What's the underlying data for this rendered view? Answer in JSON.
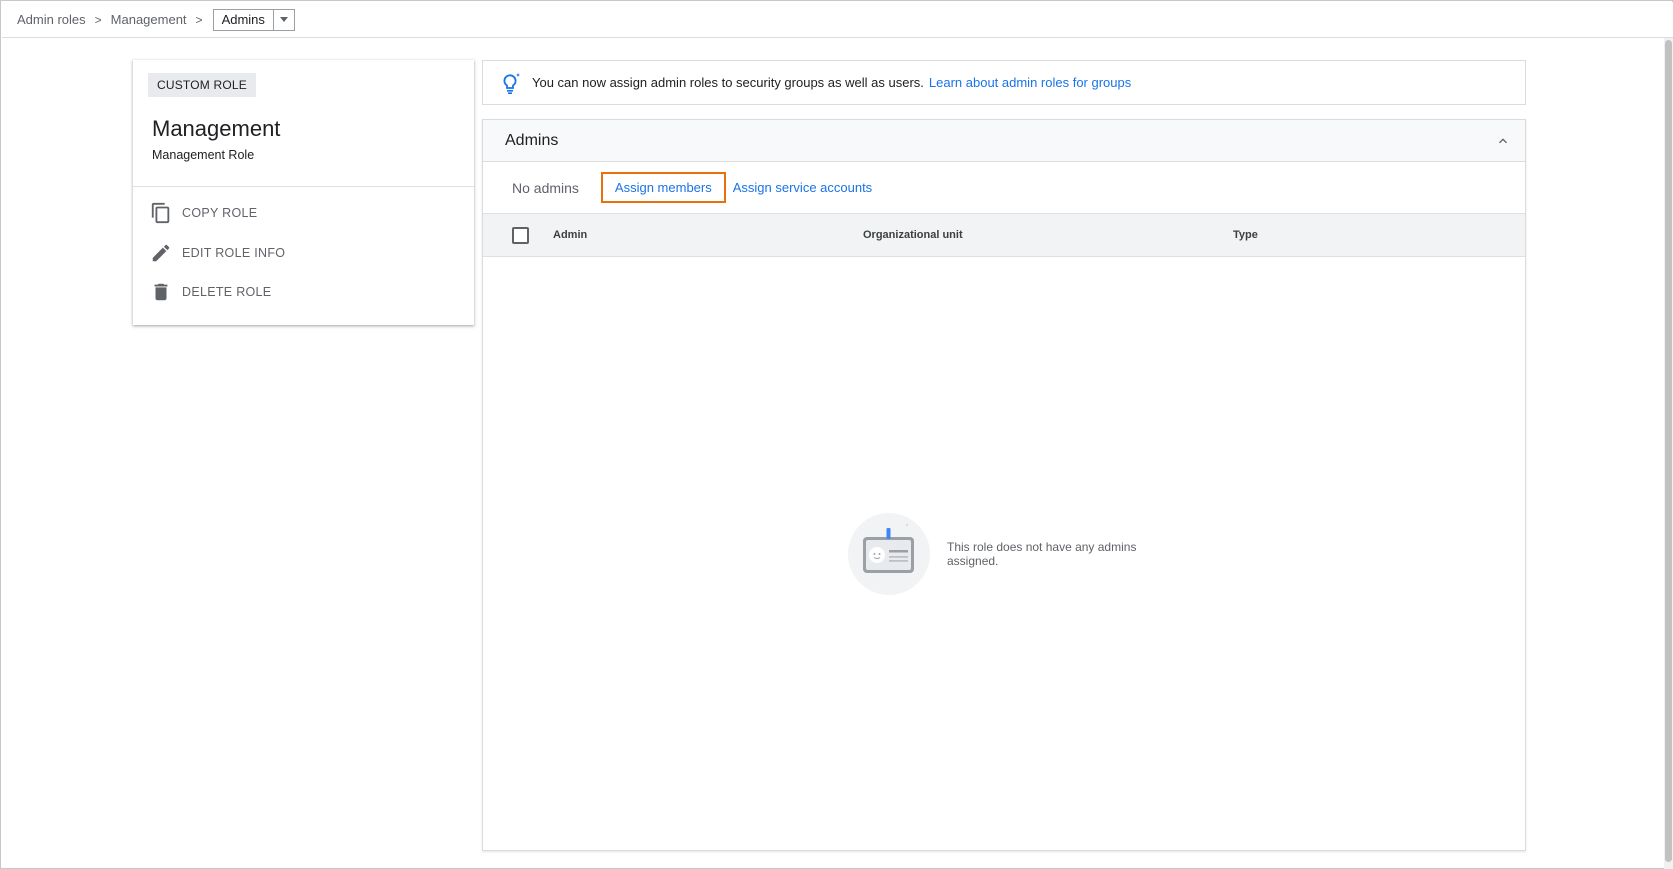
{
  "breadcrumb": {
    "items": [
      "Admin roles",
      "Management"
    ],
    "separator": ">",
    "current": "Admins"
  },
  "role": {
    "chip": "CUSTOM ROLE",
    "name": "Management",
    "description": "Management Role",
    "actions": {
      "copy": "COPY ROLE",
      "edit": "EDIT ROLE INFO",
      "delete": "DELETE ROLE"
    }
  },
  "banner": {
    "text": "You can now assign admin roles to security groups as well as users.",
    "link": "Learn about admin roles for groups"
  },
  "admins_panel": {
    "title": "Admins",
    "status": "No admins",
    "assign_members": "Assign members",
    "assign_service_accounts": "Assign service accounts",
    "columns": [
      "Admin",
      "Organizational unit",
      "Type"
    ],
    "empty_message": "This role does not have any admins assigned."
  },
  "colors": {
    "link": "#1a73e8",
    "highlight": "#e8710a",
    "header_bg": "#f1f3f4"
  },
  "icons": [
    "chevron-down-icon",
    "copy-icon",
    "pencil-icon",
    "trash-icon",
    "lightbulb-icon",
    "chevron-up-icon",
    "id-card-icon"
  ]
}
